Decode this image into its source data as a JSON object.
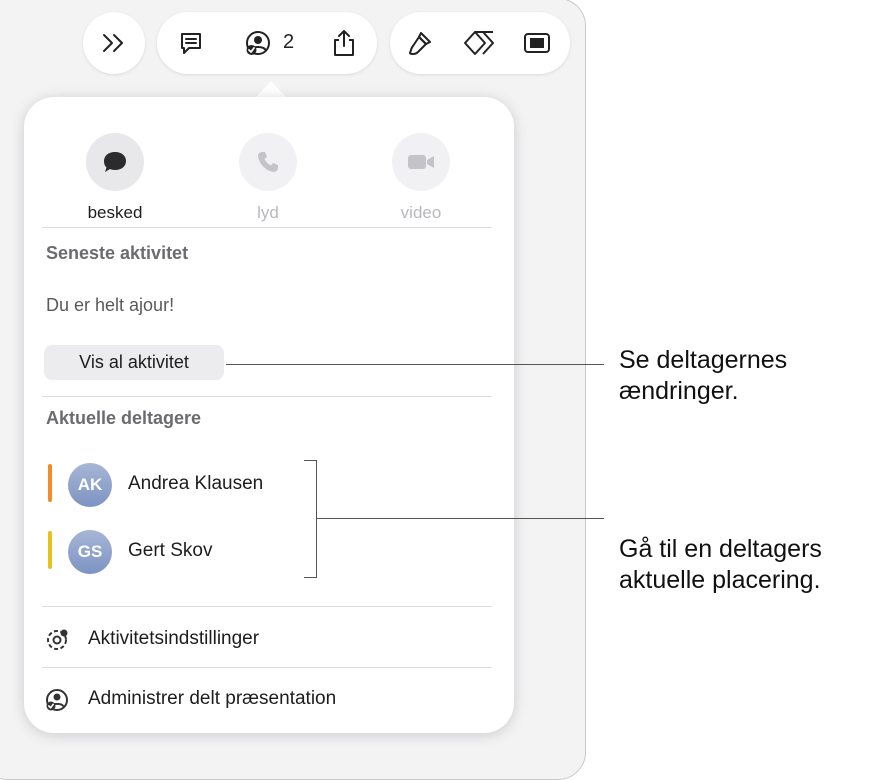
{
  "toolbar": {
    "collaborator_count": "2",
    "buttons": [
      {
        "icon": "chevrons-right-icon"
      },
      {
        "icon": "comment-icon"
      },
      {
        "icon": "collaboration-icon"
      },
      {
        "icon": "share-icon"
      },
      {
        "icon": "format-brush-icon"
      },
      {
        "icon": "animate-diamond-icon"
      },
      {
        "icon": "document-view-icon"
      }
    ]
  },
  "popover": {
    "actions": [
      {
        "label": "besked",
        "icon": "message-bubble-icon",
        "enabled": true
      },
      {
        "label": "lyd",
        "icon": "phone-icon",
        "enabled": false
      },
      {
        "label": "video",
        "icon": "video-camera-icon",
        "enabled": false
      }
    ],
    "recent_activity": {
      "heading": "Seneste aktivitet",
      "status": "Du er helt ajour!",
      "show_all_button": "Vis al aktivitet"
    },
    "participants": {
      "heading": "Aktuelle deltagere",
      "people": [
        {
          "initials": "AK",
          "name": "Andrea Klausen",
          "color": "#f28c28"
        },
        {
          "initials": "GS",
          "name": "Gert Skov",
          "color": "#e8c21a"
        }
      ]
    },
    "menu": [
      {
        "label": "Aktivitetsindstillinger",
        "icon": "activity-settings-icon"
      },
      {
        "label": "Administrer delt præsentation",
        "icon": "manage-shared-icon"
      }
    ]
  },
  "callouts": {
    "changes": [
      "Se deltagernes",
      "ændringer."
    ],
    "location": [
      "Gå til en deltagers",
      "aktuelle placering."
    ]
  }
}
